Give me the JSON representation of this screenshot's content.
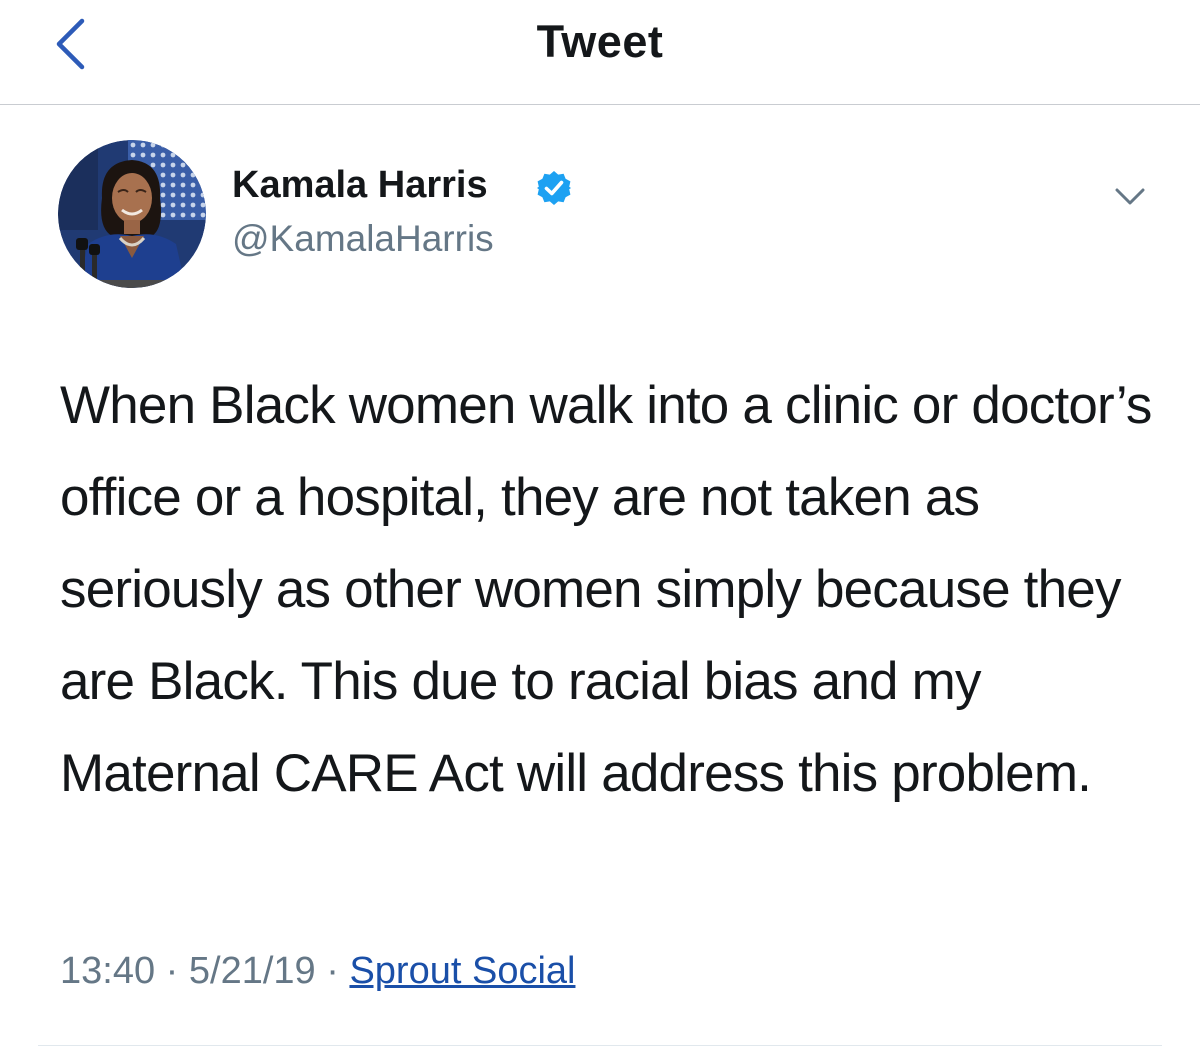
{
  "navbar": {
    "title": "Tweet",
    "back_icon": "chevron-left-icon"
  },
  "tweet": {
    "author_name": "Kamala Harris",
    "author_handle": "@KamalaHarris",
    "verified_icon": "verified-badge-icon",
    "more_icon": "chevron-down-icon",
    "text": "When Black women walk into a clinic or doctor’s office or a hospital, they are not taken as seriously as other women simply because they are Black. This due to racial bias and my Maternal CARE Act will address this problem.",
    "time": "13:40",
    "date": "5/21/19",
    "separator": "·",
    "source": "Sprout Social"
  },
  "colors": {
    "accent_blue": "#1da1f2",
    "back_arrow": "#2d5bb8",
    "text_primary": "#14171a",
    "text_secondary": "#657786",
    "source_link": "#1a4fa8"
  }
}
